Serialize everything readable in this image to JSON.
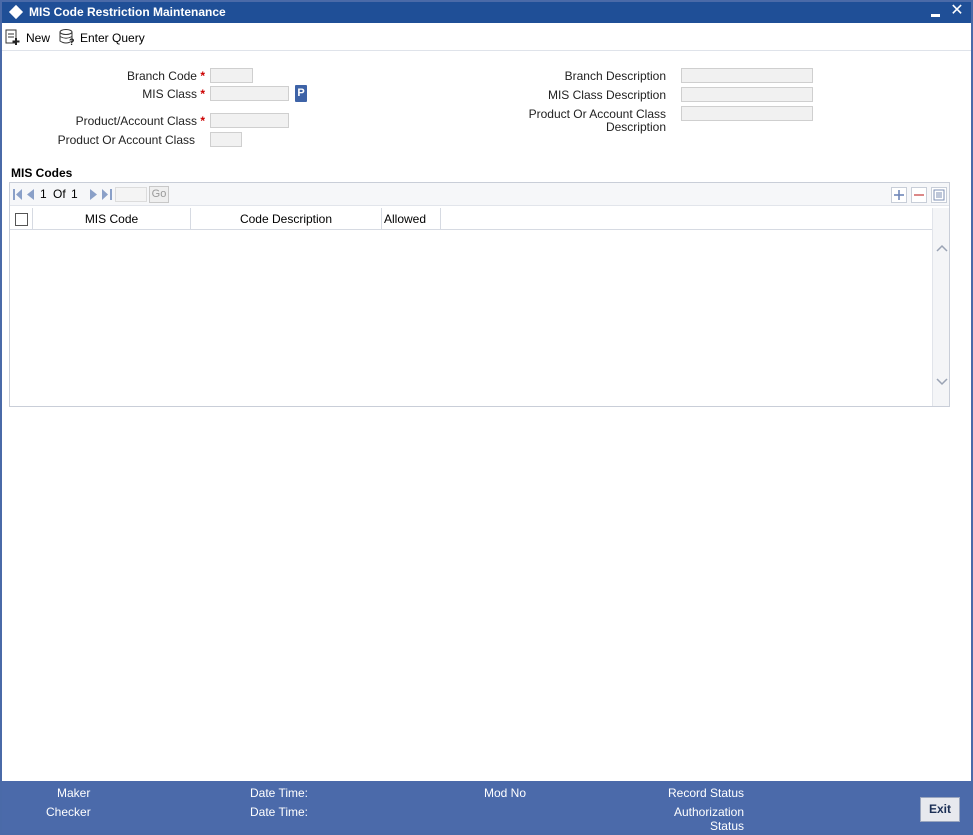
{
  "window": {
    "title": "MIS Code Restriction Maintenance"
  },
  "toolbar": {
    "new_label": "New",
    "enter_query_label": "Enter Query"
  },
  "form": {
    "branch_code_label": "Branch Code",
    "mis_class_label": "MIS Class",
    "lov_label": "P",
    "product_account_class_label": "Product/Account Class",
    "product_or_account_class_label": "Product Or Account Class",
    "branch_description_label": "Branch Description",
    "mis_class_description_label": "MIS Class Description",
    "product_or_account_class_description_label_line1": "Product Or Account Class",
    "product_or_account_class_description_label_line2": "Description",
    "required_marker": "*"
  },
  "mis_codes": {
    "section_title": "MIS Codes",
    "pagination": {
      "current": "1",
      "of_label": "Of",
      "total": "1",
      "go_label": "Go"
    },
    "columns": [
      "MIS Code",
      "Code Description",
      "Allowed"
    ],
    "rows": []
  },
  "footer": {
    "maker_label": "Maker",
    "checker_label": "Checker",
    "date_time_label_1": "Date Time:",
    "date_time_label_2": "Date Time:",
    "mod_no_label": "Mod No",
    "record_status_label": "Record Status",
    "authorization_status_label_line1": "Authorization",
    "authorization_status_label_line2": "Status",
    "exit_label": "Exit"
  },
  "colors": {
    "title_bar": "#1f4f97",
    "footer": "#4b6aaa",
    "required": "#cc0000",
    "lov_button": "#3e63a7"
  },
  "icons": {
    "new": "new-document-icon",
    "enter_query": "query-database-icon"
  }
}
